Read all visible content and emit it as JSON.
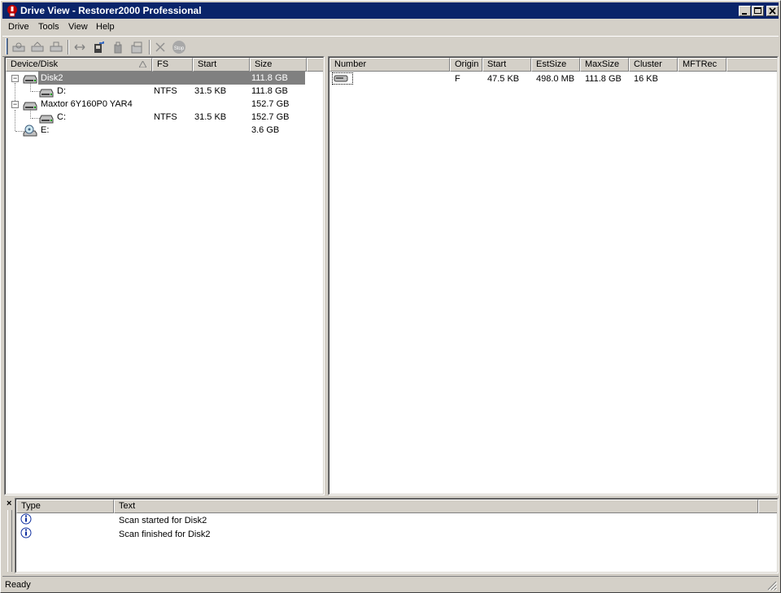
{
  "window": {
    "title": "Drive View - Restorer2000 Professional"
  },
  "menu": [
    "Drive",
    "Tools",
    "View",
    "Help"
  ],
  "toolbar": {
    "buttons": [
      "scan-drive",
      "open-scan",
      "save-scan",
      "connect-remote",
      "create-image",
      "open-image",
      "create-region",
      "delete",
      "stop"
    ]
  },
  "drives": {
    "columns": [
      "Device/Disk",
      "FS",
      "Start",
      "Size"
    ],
    "rows": [
      {
        "name": "Disk2",
        "fs": "",
        "start": "",
        "size": "111.8 GB",
        "selected": true
      },
      {
        "name": "D:",
        "fs": "NTFS",
        "start": "31.5 KB",
        "size": "111.8 GB"
      },
      {
        "name": "Maxtor 6Y160P0 YAR4",
        "fs": "",
        "start": "",
        "size": "152.7 GB"
      },
      {
        "name": "C:",
        "fs": "NTFS",
        "start": "31.5 KB",
        "size": "152.7 GB"
      },
      {
        "name": "E:",
        "fs": "",
        "start": "",
        "size": "3.6 GB"
      }
    ]
  },
  "partitions": {
    "columns": [
      "Number",
      "Origin",
      "Start",
      "EstSize",
      "MaxSize",
      "Cluster",
      "MFTRec"
    ],
    "rows": [
      {
        "number": "",
        "origin": "F",
        "start": "47.5 KB",
        "estsize": "498.0 MB",
        "maxsize": "111.8 GB",
        "cluster": "16 KB",
        "mftrec": ""
      }
    ]
  },
  "log": {
    "close_label": "×",
    "columns": [
      "Type",
      "Text"
    ],
    "rows": [
      {
        "type": "info",
        "text": "Scan started for Disk2"
      },
      {
        "type": "info",
        "text": "Scan finished for Disk2"
      }
    ]
  },
  "status": {
    "text": "Ready"
  },
  "colors": {
    "titlebar": "#0a246a",
    "selection": "#808080",
    "face": "#d4d0c8"
  }
}
